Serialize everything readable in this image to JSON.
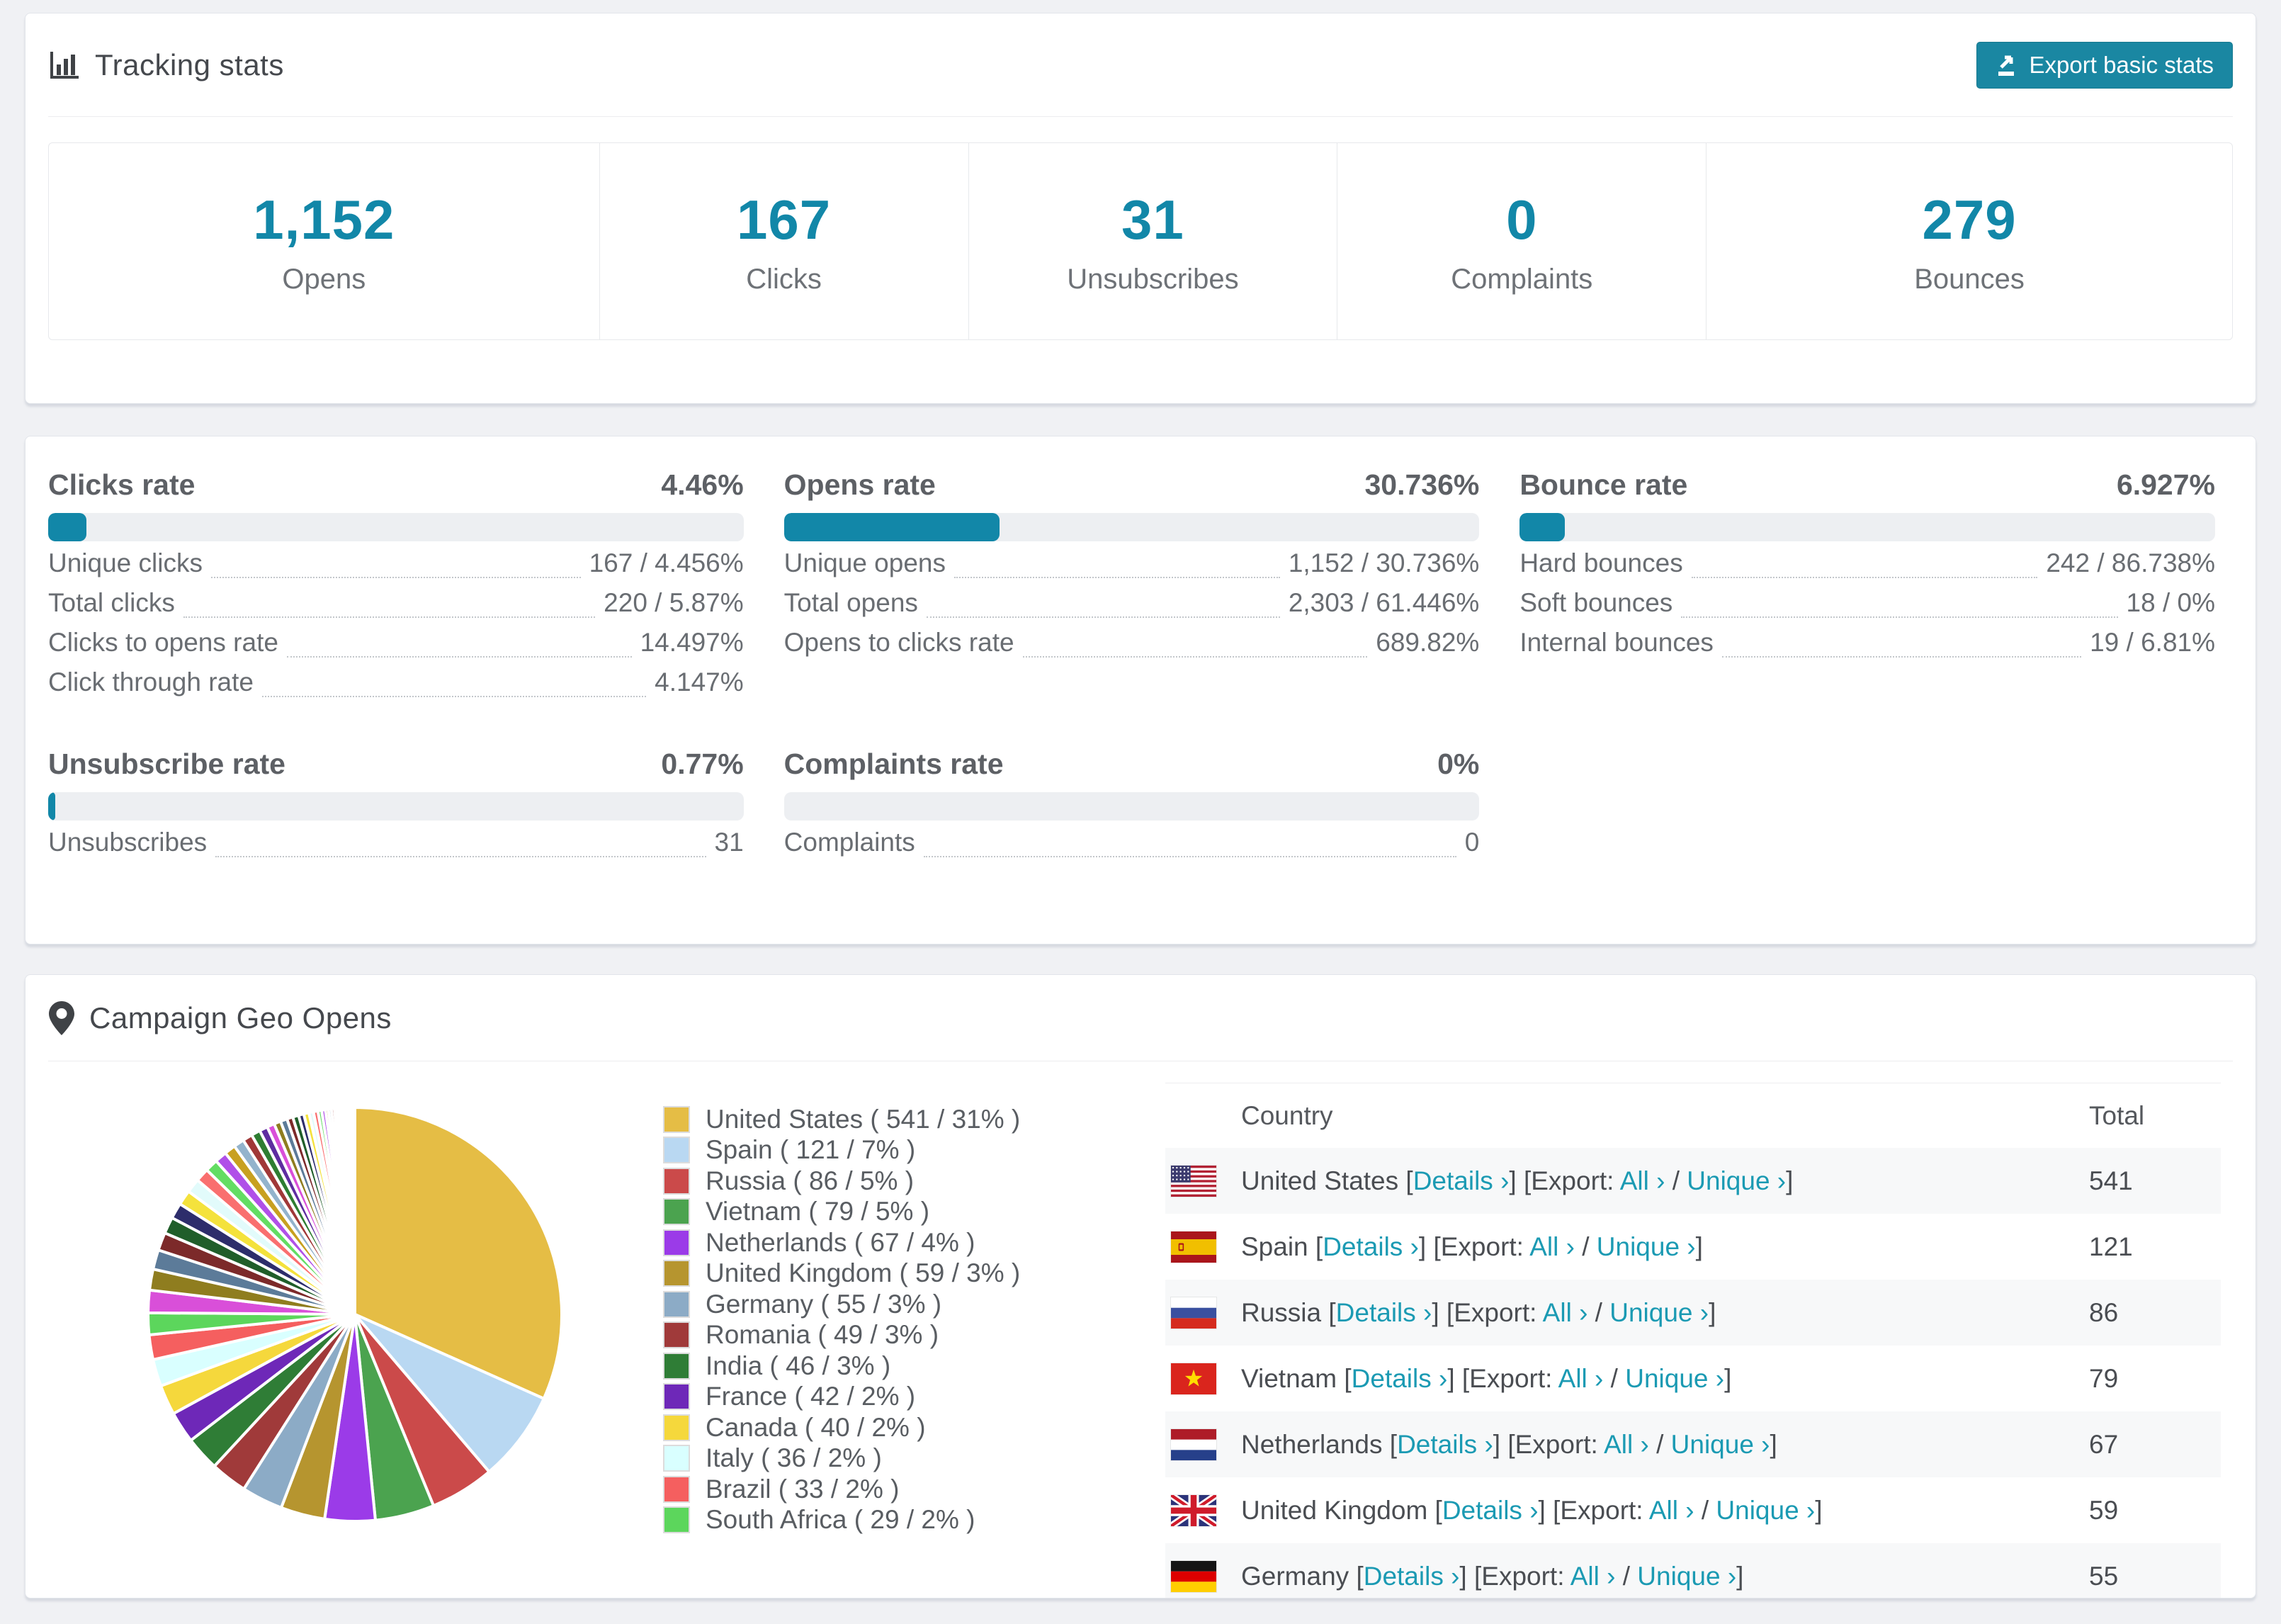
{
  "colors": {
    "accent_teal": "#1287a8",
    "link_teal": "#1b9ab3",
    "button_teal": "#1a87a2",
    "page_bg": "#f0f1f4"
  },
  "tracking": {
    "title": "Tracking stats",
    "export_button": "Export basic stats",
    "counters": [
      {
        "value": "1,152",
        "label": "Opens"
      },
      {
        "value": "167",
        "label": "Clicks"
      },
      {
        "value": "31",
        "label": "Unsubscribes"
      },
      {
        "value": "0",
        "label": "Complaints"
      },
      {
        "value": "279",
        "label": "Bounces"
      }
    ]
  },
  "rates": [
    {
      "title": "Clicks rate",
      "value": "4.46%",
      "fill_pct": 5.5,
      "rows": [
        [
          "Unique clicks",
          "167 / 4.456%"
        ],
        [
          "Total clicks",
          "220 / 5.87%"
        ],
        [
          "Clicks to opens rate",
          "14.497%"
        ],
        [
          "Click through rate",
          "4.147%"
        ]
      ]
    },
    {
      "title": "Opens rate",
      "value": "30.736%",
      "fill_pct": 31,
      "rows": [
        [
          "Unique opens",
          "1,152 / 30.736%"
        ],
        [
          "Total opens",
          "2,303 / 61.446%"
        ],
        [
          "Opens to clicks rate",
          "689.82%"
        ]
      ]
    },
    {
      "title": "Bounce rate",
      "value": "6.927%",
      "fill_pct": 6.5,
      "rows": [
        [
          "Hard bounces",
          "242 / 86.738%"
        ],
        [
          "Soft bounces",
          "18 / 0%"
        ],
        [
          "Internal bounces",
          "19 / 6.81%"
        ]
      ]
    },
    {
      "title": "Unsubscribe rate",
      "value": "0.77%",
      "fill_pct": 1,
      "rows": [
        [
          "Unsubscribes",
          "31"
        ]
      ]
    },
    {
      "title": "Complaints rate",
      "value": "0%",
      "fill_pct": 0,
      "rows": [
        [
          "Complaints",
          "0"
        ]
      ]
    }
  ],
  "geo": {
    "title": "Campaign Geo Opens",
    "table": {
      "col_country": "Country",
      "col_total": "Total",
      "details_label": "Details",
      "export_label": "Export:",
      "all_label": "All",
      "unique_label": "Unique",
      "chevron": "›",
      "rows": [
        {
          "country": "United States",
          "flag": "us",
          "total": "541"
        },
        {
          "country": "Spain",
          "flag": "es",
          "total": "121"
        },
        {
          "country": "Russia",
          "flag": "ru",
          "total": "86"
        },
        {
          "country": "Vietnam",
          "flag": "vn",
          "total": "79"
        },
        {
          "country": "Netherlands",
          "flag": "nl",
          "total": "67"
        },
        {
          "country": "United Kingdom",
          "flag": "gb",
          "total": "59"
        },
        {
          "country": "Germany",
          "flag": "de",
          "total": "55",
          "clipped": true
        }
      ]
    }
  },
  "chart_data": {
    "type": "pie",
    "title": "Campaign Geo Opens",
    "legend_position": "right",
    "slices": [
      {
        "label": "United States",
        "value": 541,
        "pct": "31%",
        "color": "#e5bd45"
      },
      {
        "label": "Spain",
        "value": 121,
        "pct": "7%",
        "color": "#b9d8f2"
      },
      {
        "label": "Russia",
        "value": 86,
        "pct": "5%",
        "color": "#cb4a4a"
      },
      {
        "label": "Vietnam",
        "value": 79,
        "pct": "5%",
        "color": "#4ba34f"
      },
      {
        "label": "Netherlands",
        "value": 67,
        "pct": "4%",
        "color": "#9b3be8"
      },
      {
        "label": "United Kingdom",
        "value": 59,
        "pct": "3%",
        "color": "#b6952f"
      },
      {
        "label": "Germany",
        "value": 55,
        "pct": "3%",
        "color": "#8cabc6"
      },
      {
        "label": "Romania",
        "value": 49,
        "pct": "3%",
        "color": "#a03a3a"
      },
      {
        "label": "India",
        "value": 46,
        "pct": "3%",
        "color": "#2f7d36"
      },
      {
        "label": "France",
        "value": 42,
        "pct": "2%",
        "color": "#6e28b8"
      },
      {
        "label": "Canada",
        "value": 40,
        "pct": "2%",
        "color": "#f5d83c"
      },
      {
        "label": "Italy",
        "value": 36,
        "pct": "2%",
        "color": "#d9ffff"
      },
      {
        "label": "Brazil",
        "value": 33,
        "pct": "2%",
        "color": "#f55f5f"
      },
      {
        "label": "South Africa",
        "value": 29,
        "pct": "2%",
        "color": "#5cd65c"
      }
    ],
    "other_slices": {
      "values": [
        30,
        28,
        26,
        24,
        22,
        21,
        20,
        19,
        18,
        17,
        16,
        15,
        14,
        13,
        12,
        11,
        10,
        9,
        9,
        8,
        8,
        7,
        7,
        6,
        6,
        5,
        5,
        4,
        4,
        4,
        3,
        3,
        3,
        2,
        2,
        2,
        2,
        2,
        1,
        1,
        1,
        1,
        1,
        1,
        1,
        1
      ],
      "colors": [
        "#d94fd9",
        "#8f7d1f",
        "#5c7b99",
        "#7c2a2a",
        "#205e2a",
        "#2d2d6b",
        "#f4e23c",
        "#e2fbfb",
        "#f96f6f",
        "#63dd63",
        "#b050e8",
        "#c8a020",
        "#93b3cc",
        "#a03838",
        "#2e7d32",
        "#5e2da0"
      ]
    }
  }
}
